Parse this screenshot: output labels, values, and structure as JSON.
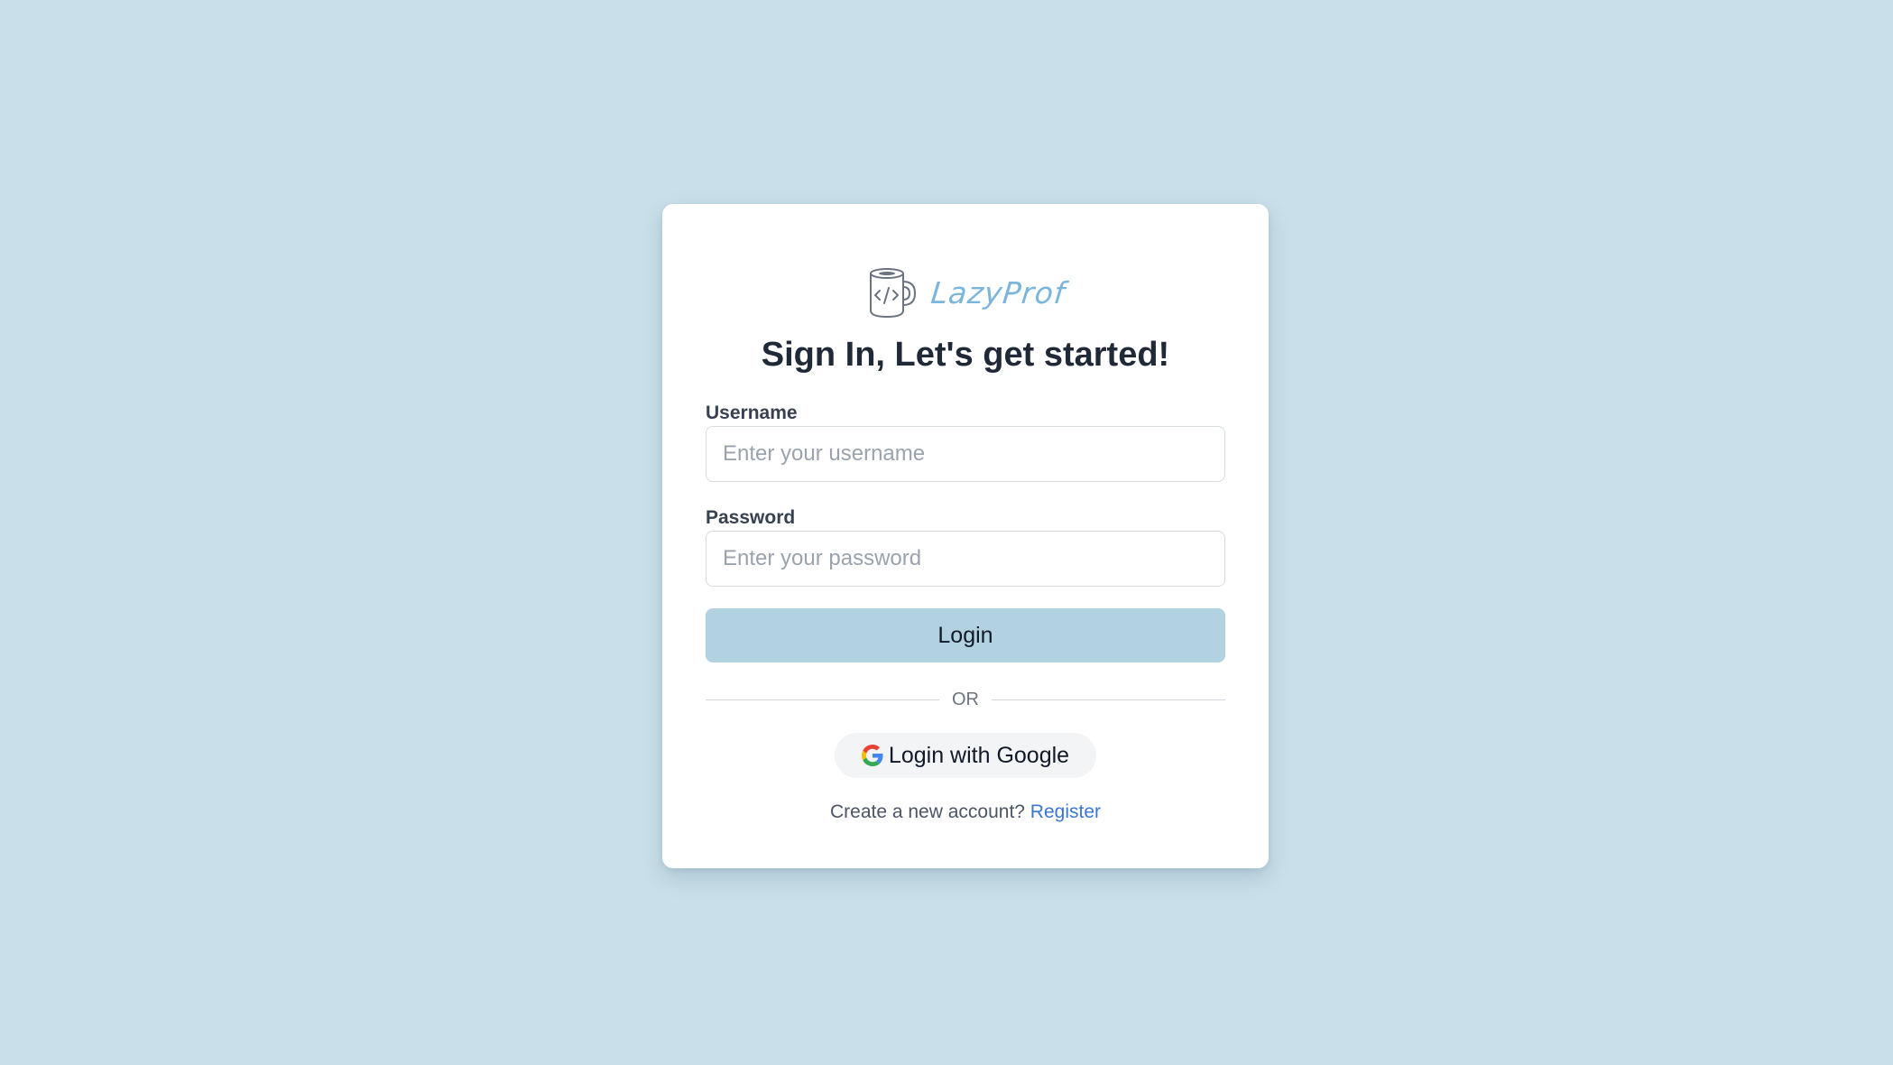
{
  "brand": {
    "name": "LazyProf",
    "logo_icon": "coffee-mug-code-icon",
    "color": "#7ab6dc"
  },
  "page": {
    "title": "Sign In, Let's get started!",
    "background": "#c9dfe9"
  },
  "form": {
    "username": {
      "label": "Username",
      "placeholder": "Enter your username",
      "value": ""
    },
    "password": {
      "label": "Password",
      "placeholder": "Enter your password",
      "value": ""
    },
    "login_label": "Login",
    "login_color": "#b2d2e1"
  },
  "divider": {
    "text": "OR"
  },
  "google": {
    "label": "Login with Google",
    "icon": "google-icon"
  },
  "register": {
    "prompt": "Create a new account?",
    "link_label": "Register",
    "link_color": "#3b76d6"
  }
}
